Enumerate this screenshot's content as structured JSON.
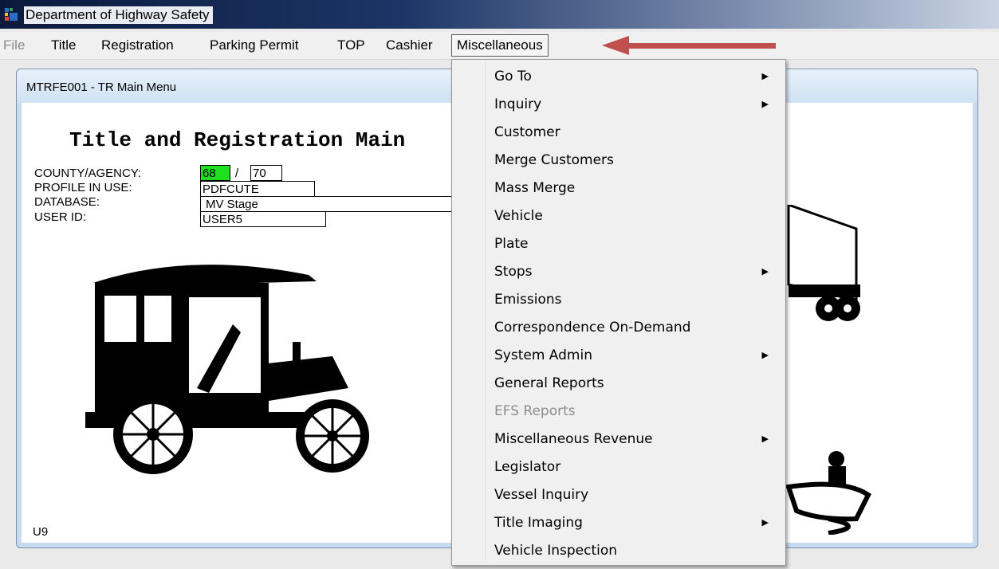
{
  "window": {
    "title": "Department of Highway Safety"
  },
  "menubar": {
    "items": [
      {
        "label": "File",
        "disabled": true
      },
      {
        "label": "Title"
      },
      {
        "label": "Registration"
      },
      {
        "label": "Parking Permit"
      },
      {
        "label": "TOP"
      },
      {
        "label": "Cashier"
      },
      {
        "label": "Miscellaneous",
        "active": true
      }
    ]
  },
  "child_window": {
    "caption": "MTRFE001 - TR Main Menu",
    "form_title": "Title and Registration Main",
    "county_agency": {
      "label": "COUNTY/AGENCY:",
      "county": "68",
      "agency": "70",
      "separator": "/"
    },
    "profile": {
      "label": "PROFILE IN USE:",
      "value": "PDFCUTE"
    },
    "database": {
      "label": "DATABASE:",
      "value": "MV Stage"
    },
    "user_id": {
      "label": "USER ID:",
      "value": "USER5"
    },
    "footer_code": "U9"
  },
  "dropdown": {
    "items": [
      {
        "label": "Go To",
        "submenu": true
      },
      {
        "label": "Inquiry",
        "submenu": true
      },
      {
        "label": "Customer"
      },
      {
        "label": "Merge Customers"
      },
      {
        "label": "Mass Merge"
      },
      {
        "label": "Vehicle"
      },
      {
        "label": "Plate"
      },
      {
        "label": "Stops",
        "submenu": true
      },
      {
        "label": "Emissions"
      },
      {
        "label": "Correspondence On-Demand"
      },
      {
        "label": "System Admin",
        "submenu": true
      },
      {
        "label": "General Reports"
      },
      {
        "label": "EFS Reports",
        "disabled": true
      },
      {
        "label": "Miscellaneous Revenue",
        "submenu": true
      },
      {
        "label": "Legislator"
      },
      {
        "label": "Vessel Inquiry"
      },
      {
        "label": "Title Imaging",
        "submenu": true
      },
      {
        "label": "Vehicle Inspection"
      }
    ]
  },
  "icons": {
    "app": "app-icon",
    "submenu": "triangle-right-icon",
    "annotation": "red-arrow-icon"
  },
  "colors": {
    "county_highlight": "#1fe01f",
    "annotation_arrow": "#c0504d",
    "disabled_text": "#8d8d8d"
  }
}
